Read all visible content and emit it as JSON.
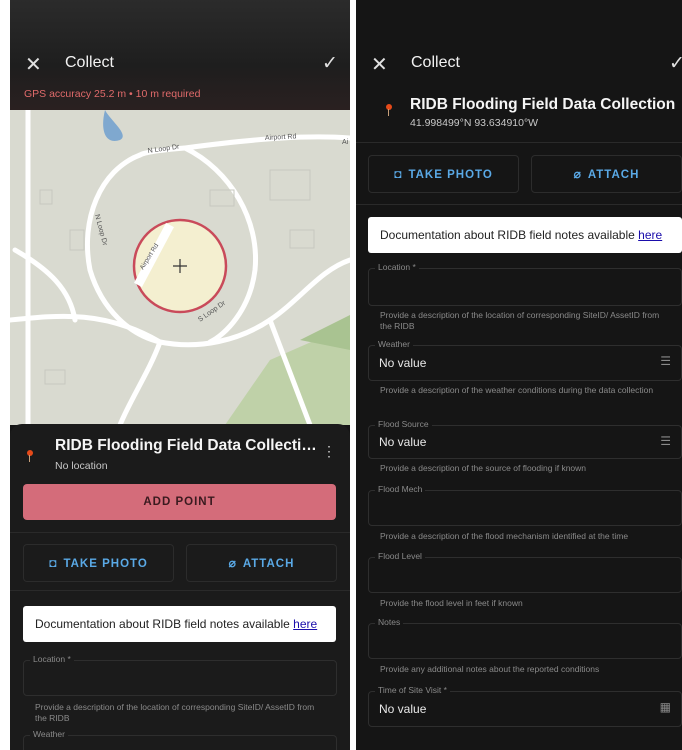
{
  "header": {
    "close_icon": "close-icon",
    "title": "Collect",
    "confirm_icon": "check-icon"
  },
  "left": {
    "gps_status": "GPS accuracy 25.2 m • 10 m required",
    "map_labels": {
      "street_1": "N Loop Dr",
      "street_2": "Airport Rd",
      "street_3": "N Loop Dr",
      "street_4": "Airport Rd",
      "street_5": "S Loop Dr",
      "street_6": "Ai"
    },
    "project_name": "RIDB Flooding Field Data Collecti…",
    "location_status": "No location",
    "add_point_label": "ADD POINT",
    "take_photo_label": "TAKE PHOTO",
    "attach_label": "ATTACH",
    "doc_text": "Documentation about RIDB field notes available ",
    "doc_link": "here",
    "location_label": "Location *",
    "location_help": "Provide a description of the location of corresponding SiteID/ AssetID from the RIDB",
    "weather_label": "Weather"
  },
  "right": {
    "project_name": "RIDB Flooding Field Data Collection",
    "coordinates": "41.998499°N  93.634910°W",
    "take_photo_label": "TAKE PHOTO",
    "attach_label": "ATTACH",
    "doc_text": "Documentation about RIDB field notes available ",
    "doc_link": "here",
    "fields": [
      {
        "label": "Location *",
        "value": "",
        "help": "Provide a description of the location of corresponding SiteID/ AssetID from the RIDB"
      },
      {
        "label": "Weather",
        "value": "No value",
        "icon": "list-icon",
        "help": "Provide a description of the weather conditions during the data collection"
      },
      {
        "label": "Flood Source",
        "value": "No value",
        "icon": "list-icon",
        "help": "Provide a description of the source of flooding if known"
      },
      {
        "label": "Flood Mech",
        "value": "",
        "help": "Provide a description of the flood mechanism identified at the time"
      },
      {
        "label": "Flood Level",
        "value": "",
        "help": "Provide the flood level in feet if known"
      },
      {
        "label": "Notes",
        "value": "",
        "help": "Provide any additional notes about the reported conditions"
      },
      {
        "label": "Time of Site Visit *",
        "value": "No value",
        "icon": "calendar-icon",
        "help": ""
      }
    ]
  },
  "colors": {
    "accent": "#5aa9e6",
    "add_point": "#d46c7a",
    "gps_warning": "#e06a6a",
    "background": "#151515"
  }
}
